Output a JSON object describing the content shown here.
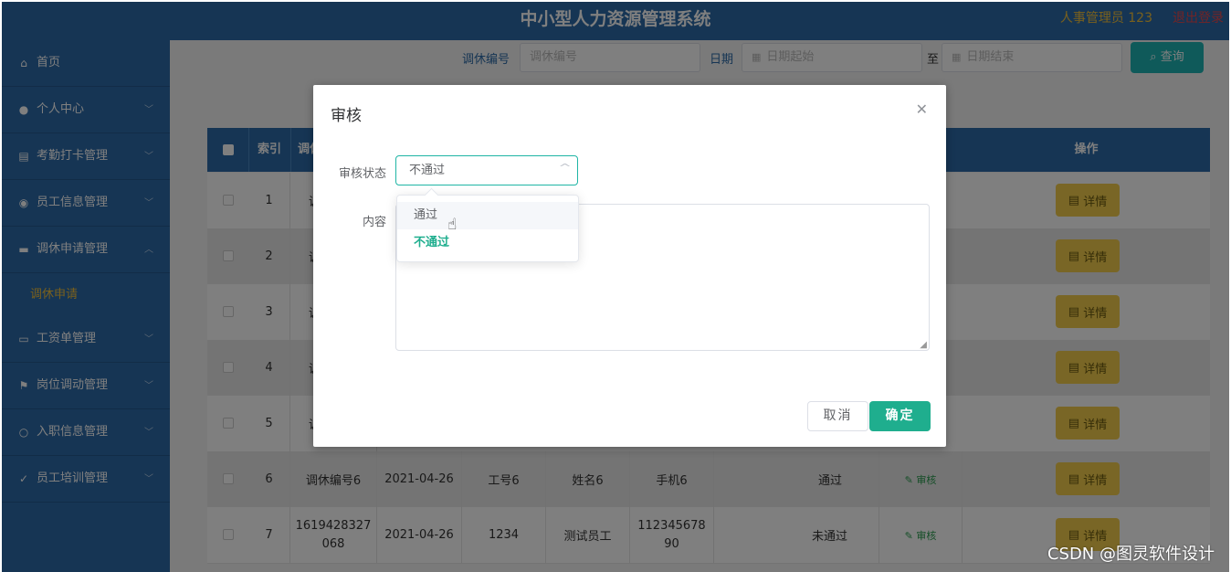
{
  "header": {
    "title": "中小型人力资源管理系统",
    "user": "人事管理员 123",
    "logout": "退出登录"
  },
  "sidebar": {
    "items": [
      {
        "label": "首页",
        "icon": "home-icon"
      },
      {
        "label": "个人中心",
        "icon": "user-icon"
      },
      {
        "label": "考勤打卡管理",
        "icon": "clipboard-icon"
      },
      {
        "label": "员工信息管理",
        "icon": "location-icon"
      },
      {
        "label": "调休申请管理",
        "icon": "briefcase-icon"
      },
      {
        "label": "工资单管理",
        "icon": "card-icon"
      },
      {
        "label": "岗位调动管理",
        "icon": "flag-icon"
      },
      {
        "label": "入职信息管理",
        "icon": "circle-icon"
      },
      {
        "label": "员工培训管理",
        "icon": "check-circle-icon"
      }
    ],
    "sub_item": "调休申请"
  },
  "filters": {
    "code_label": "调休编号",
    "code_placeholder": "调休编号",
    "date_label": "日期",
    "date_start": "日期起始",
    "date_sep": "至",
    "date_end": "日期结束",
    "search_button": "查询"
  },
  "table": {
    "columns": {
      "index": "索引",
      "code": "调休",
      "op": "操作"
    },
    "detail_label": "详情",
    "audit_label": "审核",
    "rows": [
      {
        "index": "1",
        "code": "调"
      },
      {
        "index": "2",
        "code": "调"
      },
      {
        "index": "3",
        "code": "调"
      },
      {
        "index": "4",
        "code": "调"
      },
      {
        "index": "5",
        "code": "调"
      },
      {
        "index": "6",
        "code": "调休编号6",
        "date": "2021-04-26",
        "empno": "工号6",
        "name": "姓名6",
        "phone": "手机6",
        "status": "通过"
      },
      {
        "index": "7",
        "code": "1619428327\n068",
        "date": "2021-04-26",
        "empno": "1234",
        "name": "测试员工",
        "phone": "112345678\n90",
        "status": "未通过"
      }
    ]
  },
  "dialog": {
    "title": "审核",
    "status_label": "审核状态",
    "status_value": "不通过",
    "content_label": "内容",
    "cancel": "取消",
    "confirm": "确定",
    "options": [
      "通过",
      "不通过"
    ]
  },
  "watermark": "CSDN @图灵软件设计",
  "colors": {
    "primary": "#2d6ba8",
    "accent": "#1fae8e",
    "gold": "#f3cd4d",
    "danger": "#e5484d"
  }
}
